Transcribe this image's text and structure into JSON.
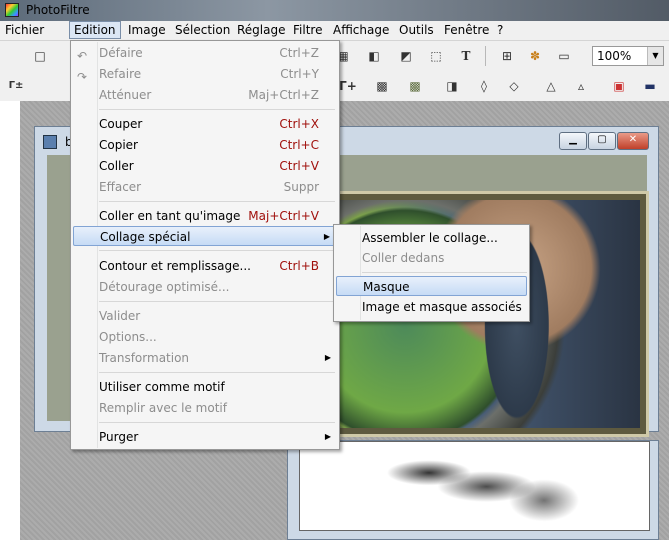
{
  "app": {
    "title": "PhotoFiltre"
  },
  "menubar": {
    "items": [
      "Fichier",
      "Edition",
      "Image",
      "Sélection",
      "Réglage",
      "Filtre",
      "Affichage",
      "Outils",
      "Fenêtre",
      "?"
    ],
    "open_index": 1
  },
  "toolbar": {
    "zoom_value": "100%"
  },
  "doc_window_1": {
    "title_fragment": "b"
  },
  "edition_menu": {
    "items": [
      {
        "label": "Défaire",
        "shortcut": "Ctrl+Z",
        "enabled": false,
        "icon": "undo-icon"
      },
      {
        "label": "Refaire",
        "shortcut": "Ctrl+Y",
        "enabled": false,
        "icon": "redo-icon"
      },
      {
        "label": "Atténuer",
        "shortcut": "Maj+Ctrl+Z",
        "enabled": false
      },
      {
        "label": "Couper",
        "shortcut": "Ctrl+X",
        "enabled": true
      },
      {
        "label": "Copier",
        "shortcut": "Ctrl+C",
        "enabled": true
      },
      {
        "label": "Coller",
        "shortcut": "Ctrl+V",
        "enabled": true
      },
      {
        "label": "Effacer",
        "shortcut": "Suppr",
        "enabled": false
      },
      {
        "label": "Coller en tant qu'image",
        "shortcut": "Maj+Ctrl+V",
        "enabled": true
      },
      {
        "label": "Collage spécial",
        "shortcut": "",
        "enabled": true,
        "submenu": true,
        "highlighted": true
      },
      {
        "label": "Contour et remplissage...",
        "shortcut": "Ctrl+B",
        "enabled": true
      },
      {
        "label": "Détourage optimisé...",
        "shortcut": "",
        "enabled": false
      },
      {
        "label": "Valider",
        "shortcut": "",
        "enabled": false
      },
      {
        "label": "Options...",
        "shortcut": "",
        "enabled": false
      },
      {
        "label": "Transformation",
        "shortcut": "",
        "enabled": false,
        "submenu": true
      },
      {
        "label": "Utiliser comme motif",
        "shortcut": "",
        "enabled": true
      },
      {
        "label": "Remplir avec le motif",
        "shortcut": "",
        "enabled": false
      },
      {
        "label": "Purger",
        "shortcut": "",
        "enabled": true,
        "submenu": true
      }
    ]
  },
  "collage_submenu": {
    "items": [
      {
        "label": "Assembler le collage...",
        "enabled": true
      },
      {
        "label": "Coller dedans",
        "enabled": false
      },
      {
        "label": "Masque",
        "enabled": true,
        "highlighted": true
      },
      {
        "label": "Image et masque associés",
        "enabled": true
      }
    ]
  },
  "colors": {
    "shortcut_red": "#a0100c",
    "highlight": "#c6dbf5",
    "disabled": "#8d8d8d"
  }
}
